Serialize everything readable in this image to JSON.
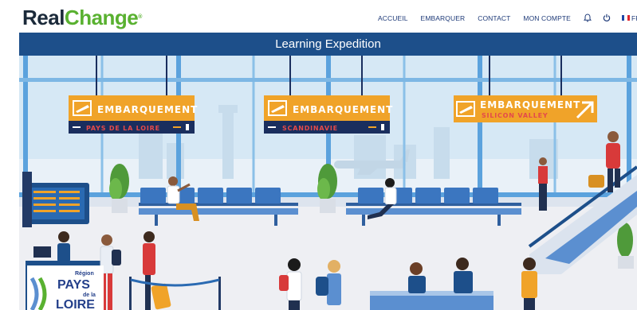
{
  "header": {
    "logo_part1": "Real",
    "logo_part2": "Change",
    "logo_mark": "®",
    "nav": [
      {
        "label": "ACCUEIL"
      },
      {
        "label": "EMBARQUER"
      },
      {
        "label": "CONTACT"
      },
      {
        "label": "MON COMPTE"
      }
    ],
    "icons": [
      "bell-icon",
      "power-icon"
    ],
    "language": {
      "label": "FR",
      "flag": "fr-flag-icon",
      "chevron": "▾"
    }
  },
  "banner": {
    "title": "Learning Expedition"
  },
  "scene": {
    "signs": [
      {
        "title": "EMBARQUEMENT",
        "destination": "PAYS DE LA LOIRE"
      },
      {
        "title": "EMBARQUEMENT",
        "destination": "SCANDINAVIE"
      },
      {
        "title": "EMBARQUEMENT",
        "destination": "SILICON VALLEY"
      }
    ],
    "region_logo": {
      "small": "Région",
      "line1": "PAYS",
      "line2": "de la",
      "line3": "LOIRE"
    }
  },
  "colors": {
    "brand_navy": "#1b2a3a",
    "brand_green": "#59b130",
    "nav_blue": "#1e3a78",
    "banner_blue": "#1d4f8a",
    "sign_orange": "#f0a329",
    "sign_navy": "#1a2e5e"
  }
}
